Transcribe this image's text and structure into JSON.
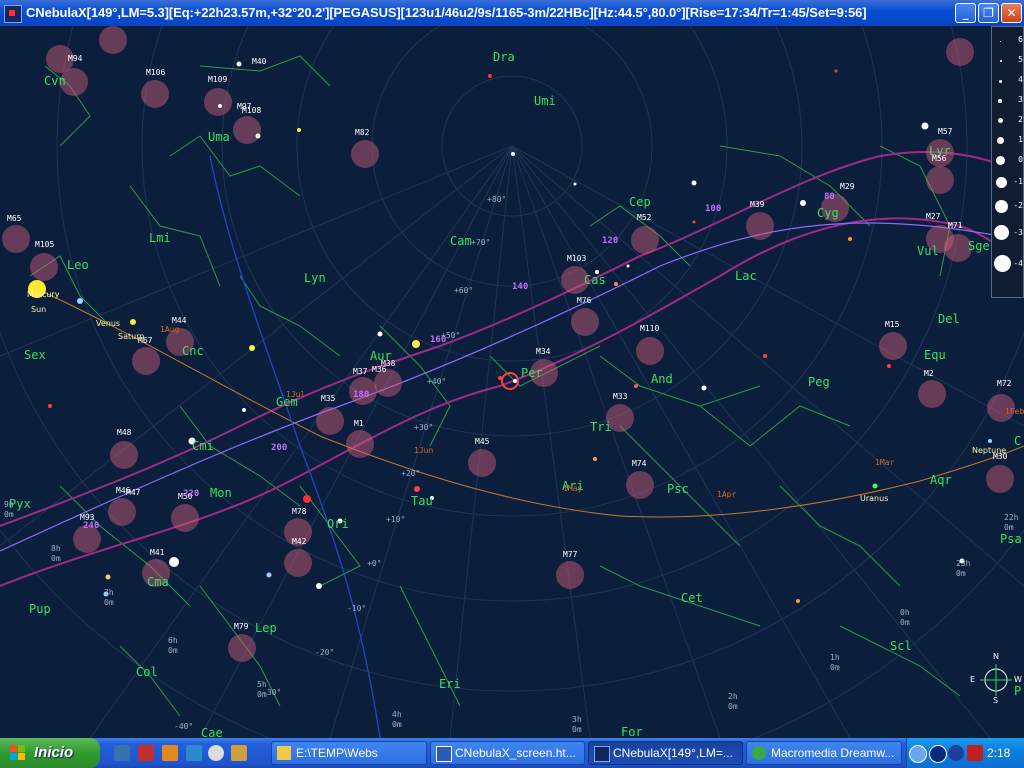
{
  "window": {
    "title": "CNebulaX[149°,LM=5.3][Eq:+22h23.57m,+32°20.2'][PEGASUS][123u1/46u2/9s/1165-3m/22HBc][Hz:44.5°,80.0°][Rise=17:34/Tr=1:45/Set=9:56]",
    "min_glyph": "_",
    "max_glyph": "❐",
    "close_glyph": "✕"
  },
  "constellations": [
    {
      "id": "cvn",
      "label": "Cvn"
    },
    {
      "id": "uma",
      "label": "Uma"
    },
    {
      "id": "dra",
      "label": "Dra"
    },
    {
      "id": "umi",
      "label": "Umi"
    },
    {
      "id": "lmi",
      "label": "Lmi"
    },
    {
      "id": "leo",
      "label": "Leo"
    },
    {
      "id": "lyn",
      "label": "Lyn"
    },
    {
      "id": "cam",
      "label": "Cam"
    },
    {
      "id": "cep",
      "label": "Cep"
    },
    {
      "id": "cyg",
      "label": "Cyg"
    },
    {
      "id": "lyr",
      "label": "Lyr"
    },
    {
      "id": "vul",
      "label": "Vul"
    },
    {
      "id": "sge",
      "label": "Sge"
    },
    {
      "id": "cas",
      "label": "Cas"
    },
    {
      "id": "lac",
      "label": "Lac"
    },
    {
      "id": "del",
      "label": "Del"
    },
    {
      "id": "sex",
      "label": "Sex"
    },
    {
      "id": "cnc",
      "label": "Cnc"
    },
    {
      "id": "aur",
      "label": "Aur"
    },
    {
      "id": "per",
      "label": "Per"
    },
    {
      "id": "and",
      "label": "And"
    },
    {
      "id": "peg",
      "label": "Peg"
    },
    {
      "id": "equ",
      "label": "Equ"
    },
    {
      "id": "gem",
      "label": "Gem"
    },
    {
      "id": "tri",
      "label": "Tri"
    },
    {
      "id": "cmi",
      "label": "Cmi"
    },
    {
      "id": "pyx",
      "label": "Pyx"
    },
    {
      "id": "mon",
      "label": "Mon"
    },
    {
      "id": "ari",
      "label": "Ari"
    },
    {
      "id": "psc",
      "label": "Psc"
    },
    {
      "id": "aqr",
      "label": "Aqr"
    },
    {
      "id": "tau",
      "label": "Tau"
    },
    {
      "id": "ori",
      "label": "Ori"
    },
    {
      "id": "cma",
      "label": "Cma"
    },
    {
      "id": "pup",
      "label": "Pup"
    },
    {
      "id": "cet",
      "label": "Cet"
    },
    {
      "id": "psa",
      "label": "Psa"
    },
    {
      "id": "lep",
      "label": "Lep"
    },
    {
      "id": "scl",
      "label": "Scl"
    },
    {
      "id": "col",
      "label": "Col"
    },
    {
      "id": "eri",
      "label": "Eri"
    },
    {
      "id": "for",
      "label": "For"
    },
    {
      "id": "cae",
      "label": "Cae"
    },
    {
      "id": "c",
      "label": "C"
    },
    {
      "id": "p",
      "label": "P"
    }
  ],
  "messier": [
    "M94",
    "M106",
    "M40",
    "M109",
    "M97",
    "M108",
    "M82",
    "M65",
    "M105",
    "M57",
    "M56",
    "M29",
    "M39",
    "M27",
    "M71",
    "M52",
    "M103",
    "M76",
    "M110",
    "M15",
    "M2",
    "M72",
    "M44",
    "M67",
    "M38",
    "M36",
    "M37",
    "M34",
    "M35",
    "M1",
    "M33",
    "M45",
    "M74",
    "M48",
    "M46",
    "M47",
    "M50",
    "M93",
    "M78",
    "M42",
    "M41",
    "M77",
    "M79",
    "M30",
    "1Feb"
  ],
  "planets": [
    {
      "label": "Sun"
    },
    {
      "label": "Venus"
    },
    {
      "label": "Saturn"
    },
    {
      "label": "Mercury"
    },
    {
      "label": "Uranus"
    },
    {
      "label": "Neptune"
    }
  ],
  "ecliptic_marks": [
    "80",
    "100",
    "120",
    "140",
    "160",
    "180",
    "200",
    "220",
    "240"
  ],
  "ecliptic_dates": [
    "1Aug",
    "1Jul",
    "1Jun",
    "1May",
    "1Apr",
    "1Mar"
  ],
  "grid_labels": [
    "+80°",
    "+70°",
    "+60°",
    "+50°",
    "+40°",
    "+30°",
    "+20°",
    "+10°",
    "+0°",
    "-10°",
    "-20°",
    "-30°",
    "-40°",
    "6h",
    "0m",
    "7h",
    "0m",
    "8h",
    "0m",
    "9h",
    "0m",
    "5h",
    "0m",
    "4h",
    "0m",
    "3h",
    "0m",
    "2h",
    "0m",
    "1h",
    "0m",
    "0h",
    "0m",
    "23h",
    "0m",
    "22h",
    "0m"
  ],
  "magnitude_legend": [
    "6",
    "5",
    "4",
    "3",
    "2",
    "1",
    "0",
    "-1",
    "-2",
    "-3",
    "-4"
  ],
  "compass": {
    "n": "N",
    "s": "S",
    "e": "E",
    "w": "W"
  },
  "taskbar": {
    "start_label": "Inicio",
    "tasks": [
      {
        "label": "E:\\TEMP\\Webs"
      },
      {
        "label": "CNebulaX_screen.ht..."
      },
      {
        "label": "CNebulaX[149°,LM=..."
      },
      {
        "label": "Macromedia Dreamw..."
      }
    ],
    "clock": "2:18"
  }
}
